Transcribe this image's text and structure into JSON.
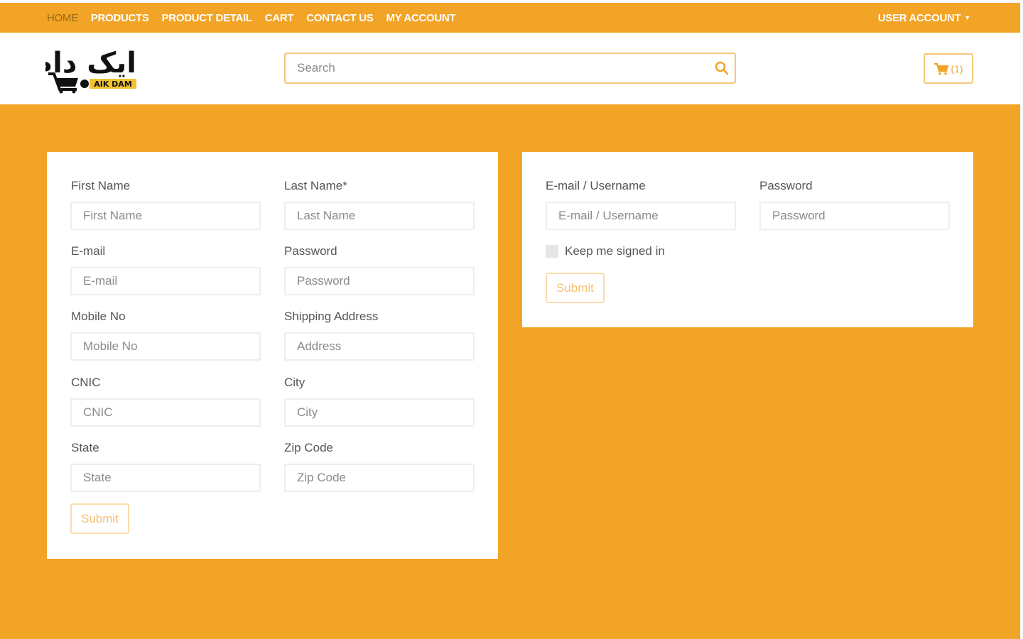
{
  "nav": {
    "links": [
      "HOME",
      "PRODUCTS",
      "PRODUCT DETAIL",
      "CART",
      "CONTACT US",
      "MY ACCOUNT"
    ],
    "user_account": "USER ACCOUNT"
  },
  "logo": {
    "urdu_text": "ایک دام",
    "english_text": "AIK DAM"
  },
  "search": {
    "placeholder": "Search"
  },
  "cart": {
    "count_label": "(1)"
  },
  "register": {
    "first_name_label": "First Name",
    "first_name_placeholder": "First Name",
    "last_name_label": "Last Name*",
    "last_name_placeholder": "Last Name",
    "email_label": "E-mail",
    "email_placeholder": "E-mail",
    "password_label": "Password",
    "password_placeholder": "Password",
    "mobile_label": "Mobile No",
    "mobile_placeholder": "Mobile No",
    "shipping_label": "Shipping Address",
    "shipping_placeholder": "Address",
    "cnic_label": "CNIC",
    "cnic_placeholder": "CNIC",
    "city_label": "City",
    "city_placeholder": "City",
    "state_label": "State",
    "state_placeholder": "State",
    "zip_label": "Zip Code",
    "zip_placeholder": "Zip Code",
    "submit_label": "Submit"
  },
  "login": {
    "username_label": "E-mail / Username",
    "username_placeholder": "E-mail / Username",
    "password_label": "Password",
    "password_placeholder": "Password",
    "remember_label": "Keep me signed in",
    "submit_label": "Submit"
  },
  "colors": {
    "brand_orange": "#f2a427",
    "white": "#ffffff"
  }
}
